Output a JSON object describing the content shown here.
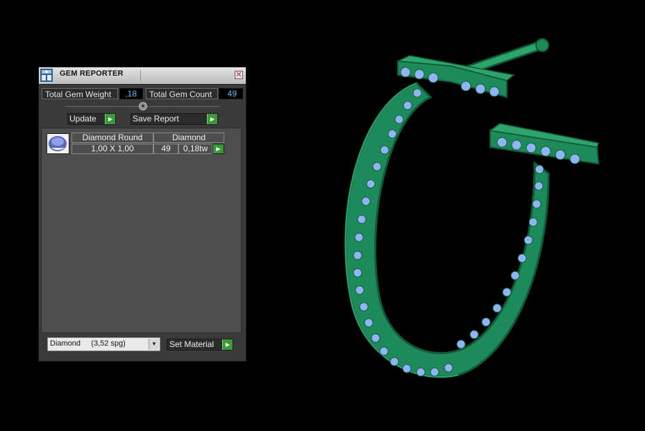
{
  "window": {
    "title": "GEM REPORTER",
    "close_symbol": "✕"
  },
  "stats": {
    "total_weight_label": "Total Gem Weight",
    "total_weight_value": ",18",
    "total_count_label": "Total Gem Count",
    "total_count_value": "49"
  },
  "toolbar": {
    "update_label": "Update",
    "save_report_label": "Save Report",
    "arrow_symbol": "▶"
  },
  "gem_table": {
    "rows": [
      {
        "shape": "Diamond Round",
        "material": "Diamond",
        "size": "1,00 X 1,00",
        "count": "49",
        "weight": "0,18tw"
      }
    ]
  },
  "material_select": {
    "value": "Diamond     (3,52 spg)",
    "dropdown_symbol": "▼"
  },
  "set_material_label": "Set Material",
  "viewport": {
    "model": "jewelry-ring-with-gems",
    "metal_color": "#1e8a5a",
    "gem_color": "#8fb4f2"
  }
}
